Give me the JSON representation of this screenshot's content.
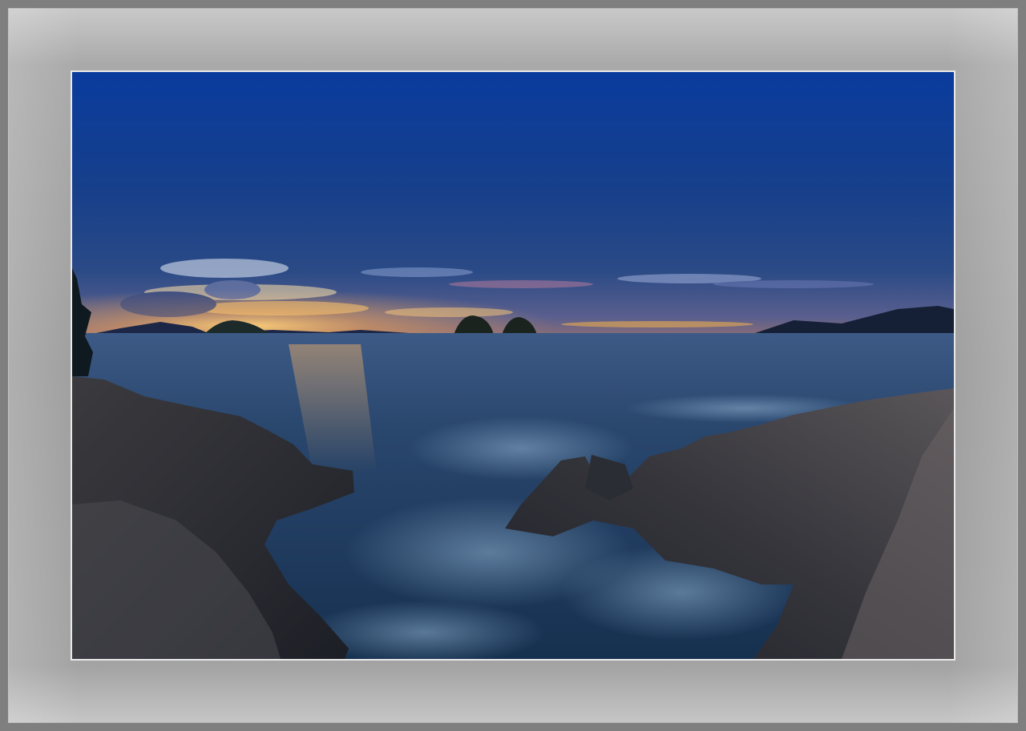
{
  "scene": {
    "subject": "rocky-coastline-at-dusk",
    "colors": {
      "frame_outer": "#7f7f7f",
      "mat": "#a3a3a3",
      "photo_border": "#e8e8e8",
      "sky_top": "#0b3c9c",
      "sky_mid": "#17408a",
      "horizon_glow": "#f2b54a",
      "sea": "#1d3f63",
      "rock": "#2a2b31"
    }
  }
}
